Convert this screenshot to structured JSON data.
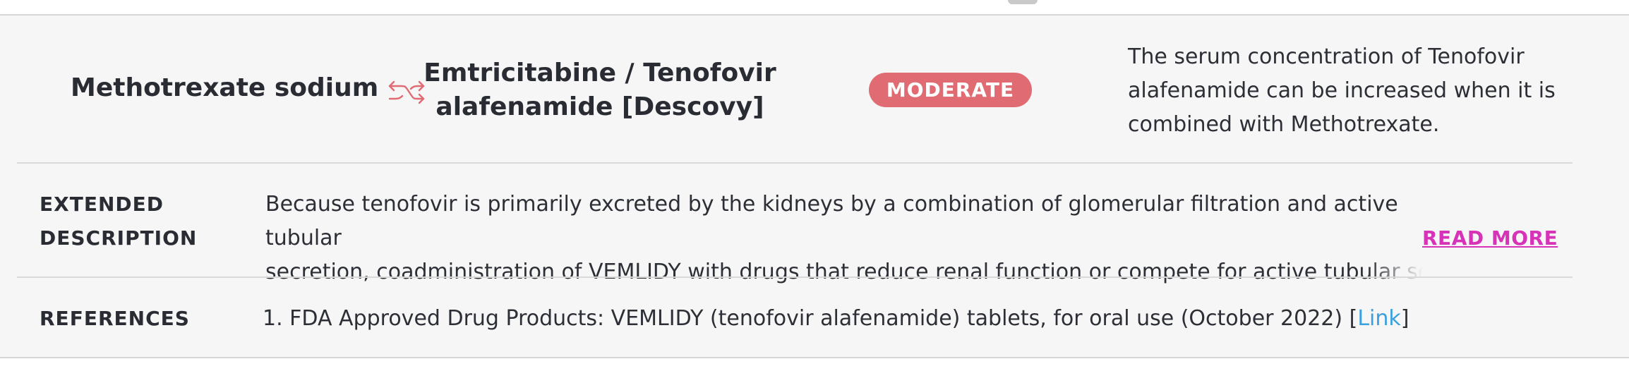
{
  "interaction": {
    "drug_a": "Methotrexate sodium",
    "drug_b": "Emtricitabine / Tenofovir alafenamide [Descovy]",
    "severity": "MODERATE",
    "summary": "The serum concentration of Tenofovir alafenamide can be increased when it is combined with Methotrexate.",
    "swap_icon": "swap-arrows-icon",
    "colors": {
      "severity_badge": "#e06b72",
      "swap_icon": "#e06b72",
      "read_more": "#d633b8",
      "link": "#3ba0dd"
    }
  },
  "extended": {
    "label_line1": "EXTENDED",
    "label_line2": "DESCRIPTION",
    "text_line1": "Because tenofovir is primarily excreted by the kidneys by a combination of glomerular filtration and active tubular",
    "text_line2": "secretion, coadministration of VEMLIDY with drugs that reduce renal function or compete for active tubular se",
    "read_more": "READ MORE"
  },
  "references": {
    "label": "REFERENCES",
    "items": [
      {
        "text": "1. FDA Approved Drug Products: VEMLIDY (tenofovir alafenamide) tablets, for oral use (October 2022) [",
        "link_text": "Link",
        "suffix": "]"
      }
    ]
  }
}
